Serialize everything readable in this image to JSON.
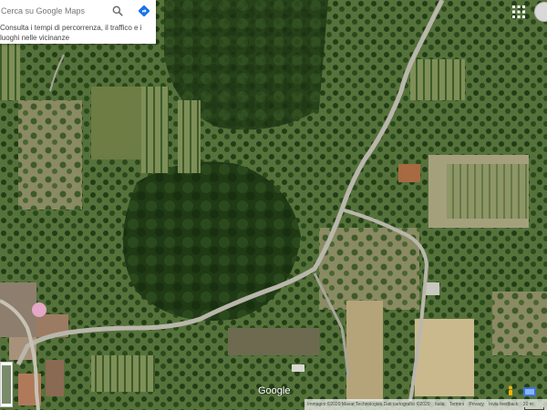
{
  "search": {
    "placeholder": "Cerca su Google Maps",
    "hint": "Consulta i tempi di percorrenza, il traffico e i luoghi nelle vicinanze"
  },
  "branding": {
    "logo": "Google"
  },
  "footer": {
    "attribution": "Immagini ©2020 Maxar Technologies,Dati cartografici ©2020",
    "country": "Italia",
    "terms": "Termini",
    "privacy": "Privacy",
    "feedback": "Invia feedback",
    "scale": "20 m"
  },
  "icons": {
    "search": "search-icon",
    "directions": "directions-icon",
    "apps": "apps-grid-icon",
    "pegman": "pegman-icon",
    "layers": "layers-icon"
  },
  "colors": {
    "accent_blue": "#1a73e8",
    "road": "#b9b6ab",
    "vegetation": "#2f4a22"
  }
}
